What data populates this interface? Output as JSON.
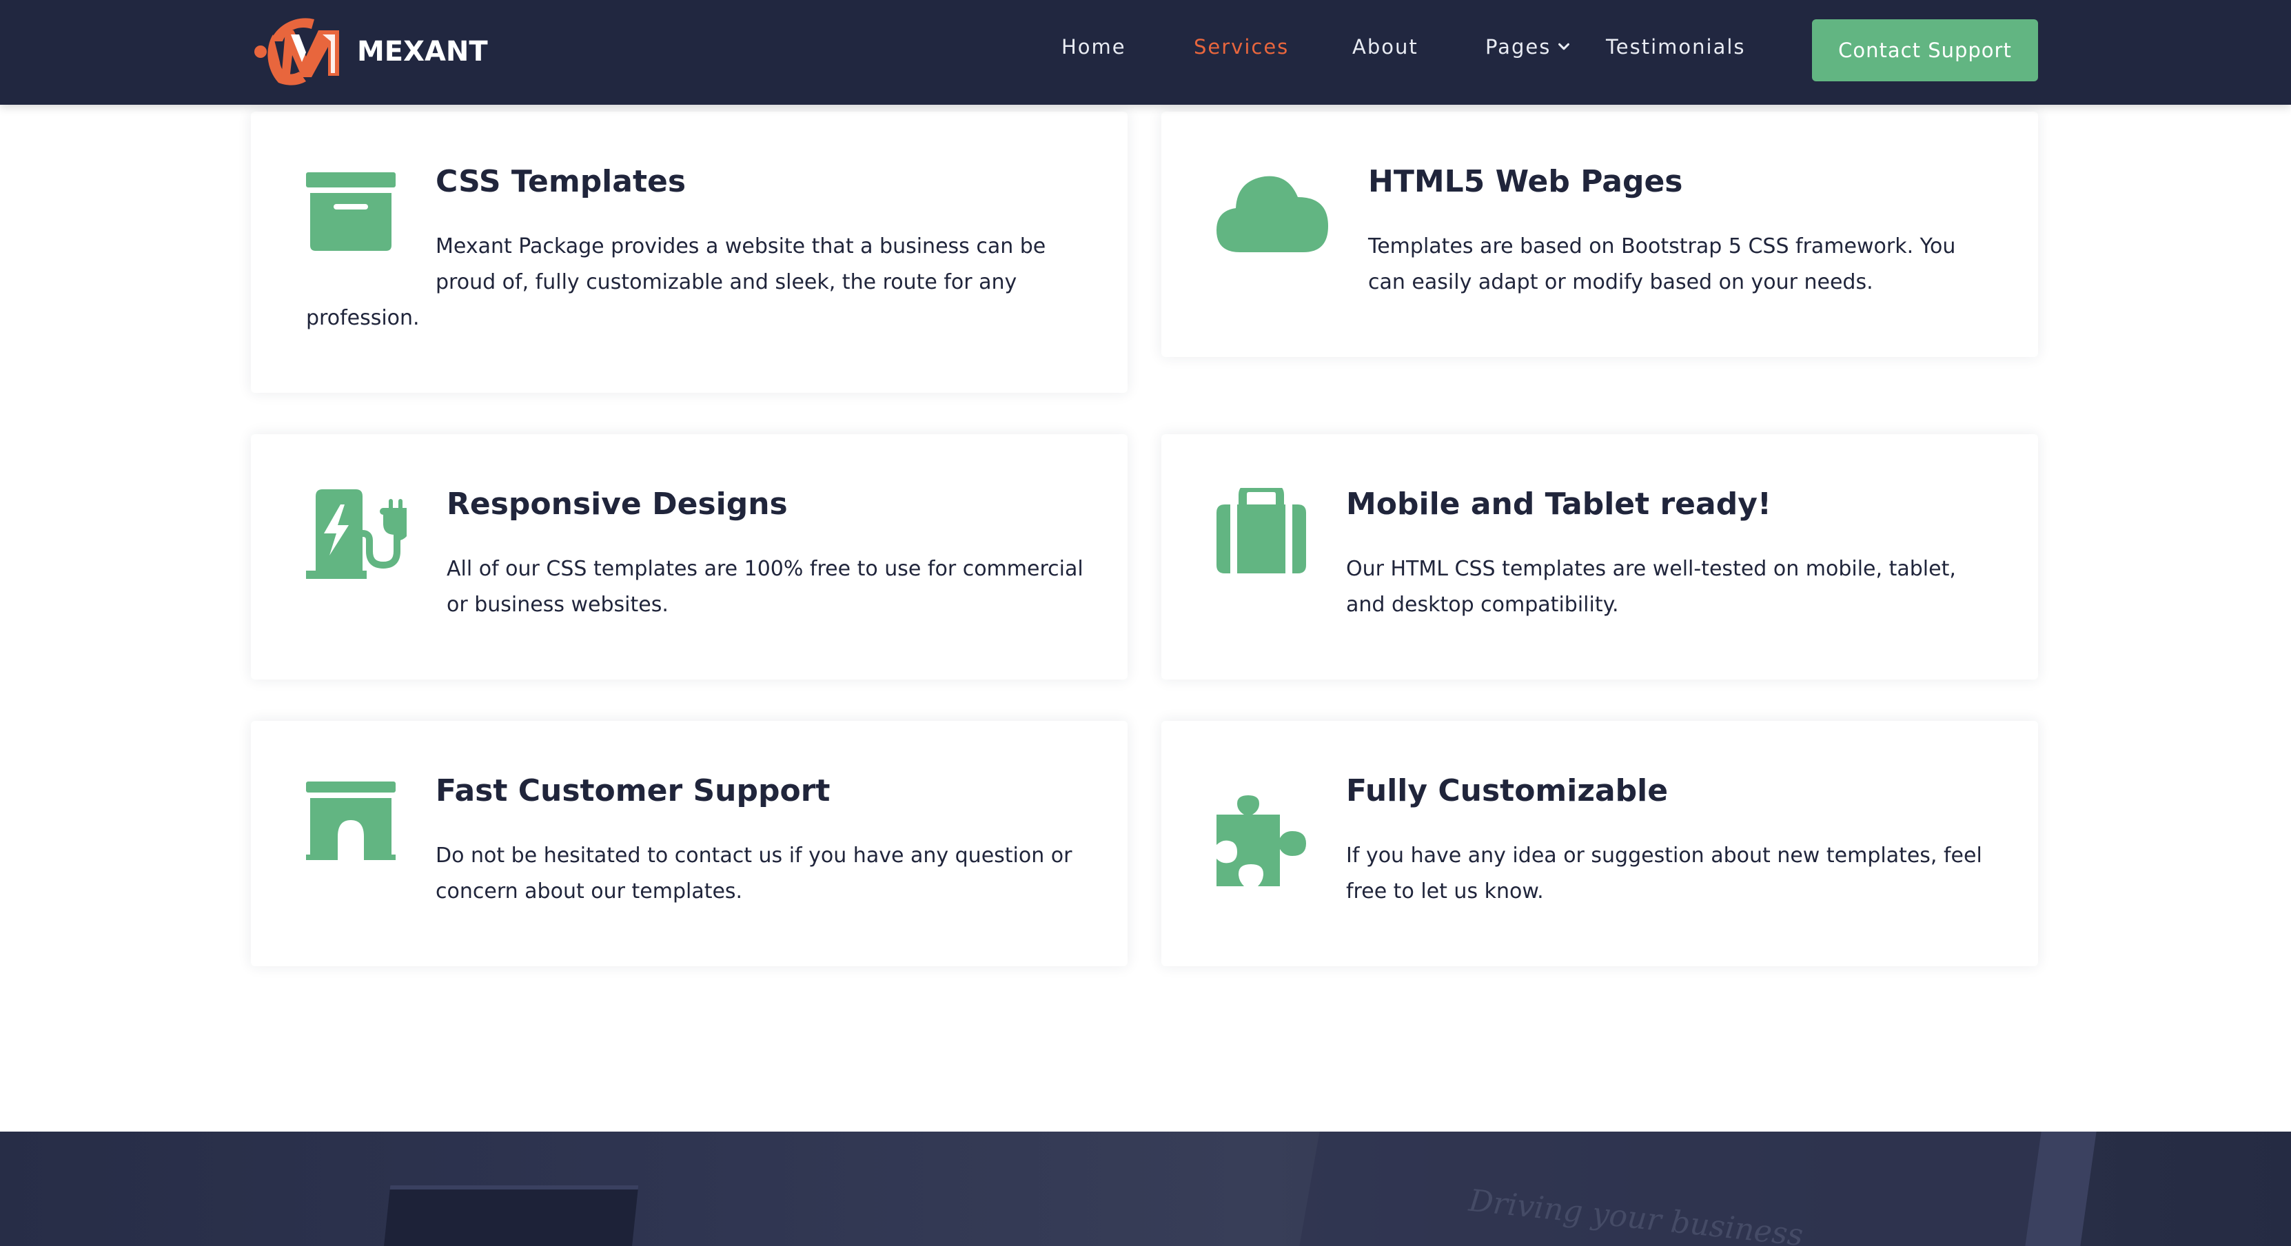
{
  "brand": {
    "name": "MEXANT",
    "accent": "#e8663d",
    "primary_green": "#62b582",
    "header_bg": "#212740"
  },
  "nav": {
    "items": [
      {
        "label": "Home"
      },
      {
        "label": "Services"
      },
      {
        "label": "About"
      },
      {
        "label": "Pages"
      },
      {
        "label": "Testimonials"
      }
    ],
    "cta_label": "Contact Support"
  },
  "services": [
    {
      "icon": "archive-box-icon",
      "title": "CSS Templates",
      "desc_lines": [
        "Mexant Package provides a website that a business can be",
        "proud of, fully customizable and sleek, the route for any",
        "profession."
      ]
    },
    {
      "icon": "cloud-icon",
      "title": "HTML5 Web Pages",
      "desc_lines": [
        "Templates are based on Bootstrap 5 CSS framework. You",
        "can easily adapt or modify based on your needs."
      ]
    },
    {
      "icon": "charging-station-icon",
      "title": "Responsive Designs",
      "desc_lines": [
        "All of our CSS templates are 100% free to use for commercial",
        "or business websites."
      ]
    },
    {
      "icon": "suitcase-icon",
      "title": "Mobile and Tablet ready!",
      "desc_lines": [
        "Our HTML CSS templates are well-tested on mobile, tablet,",
        "and desktop compatibility."
      ]
    },
    {
      "icon": "archway-icon",
      "title": "Fast Customer Support",
      "desc_lines": [
        "Do not be hesitated to contact us if you have any question or",
        "concern about our templates."
      ]
    },
    {
      "icon": "puzzle-piece-icon",
      "title": "Fully Customizable",
      "desc_lines": [
        "If you have any idea or suggestion about new templates, feel",
        "free to let us know."
      ]
    }
  ],
  "banner": {
    "text": "Driving your business"
  }
}
